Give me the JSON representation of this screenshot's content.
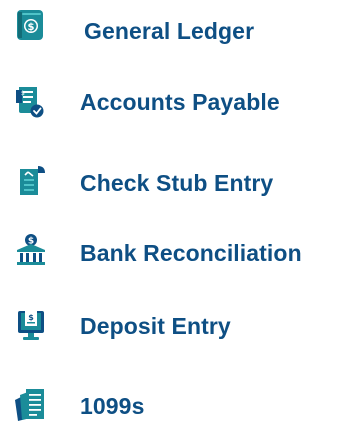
{
  "menu": {
    "items": [
      {
        "label": "General Ledger",
        "icon": "ledger-book-icon"
      },
      {
        "label": "Accounts Payable",
        "icon": "invoice-check-icon"
      },
      {
        "label": "Check Stub Entry",
        "icon": "check-stub-icon"
      },
      {
        "label": "Bank Reconciliation",
        "icon": "bank-icon"
      },
      {
        "label": "Deposit Entry",
        "icon": "deposit-terminal-icon"
      },
      {
        "label": "1099s",
        "icon": "tax-forms-icon"
      }
    ]
  },
  "colors": {
    "label": "#0e4f84",
    "icon_primary": "#1b8c99",
    "icon_light": "#4fc3c8",
    "icon_dark": "#0e4f84"
  }
}
